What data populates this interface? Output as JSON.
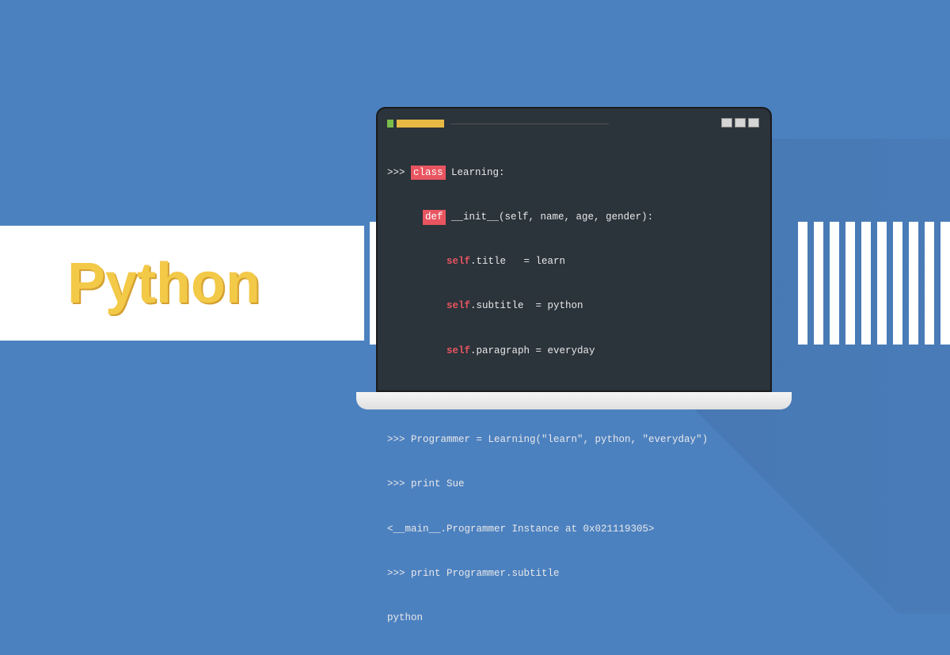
{
  "banner": {
    "title": "Python"
  },
  "code": {
    "line1_prompt": ">>> ",
    "line1_keyword": "class",
    "line1_name": " Learning:",
    "line2_indent": "      ",
    "line2_keyword": "def",
    "line2_text": " __init__(self, name, age, gender):",
    "line3_indent": "          ",
    "line3_keyword": "self",
    "line3_text": ".title   = learn",
    "line4_indent": "          ",
    "line4_keyword": "self",
    "line4_text": ".subtitle  = python",
    "line5_indent": "          ",
    "line5_keyword": "self",
    "line5_text": ".paragraph = everyday",
    "line6_text": ">>> Programmer = Learning(\"learn\", python, \"everyday\")",
    "line7_text": ">>> print Sue",
    "line8_text": "<__main__.Programmer Instance at 0x021119305>",
    "line9_text": ">>> print Programmer.subtitle",
    "line10_text": "python"
  }
}
